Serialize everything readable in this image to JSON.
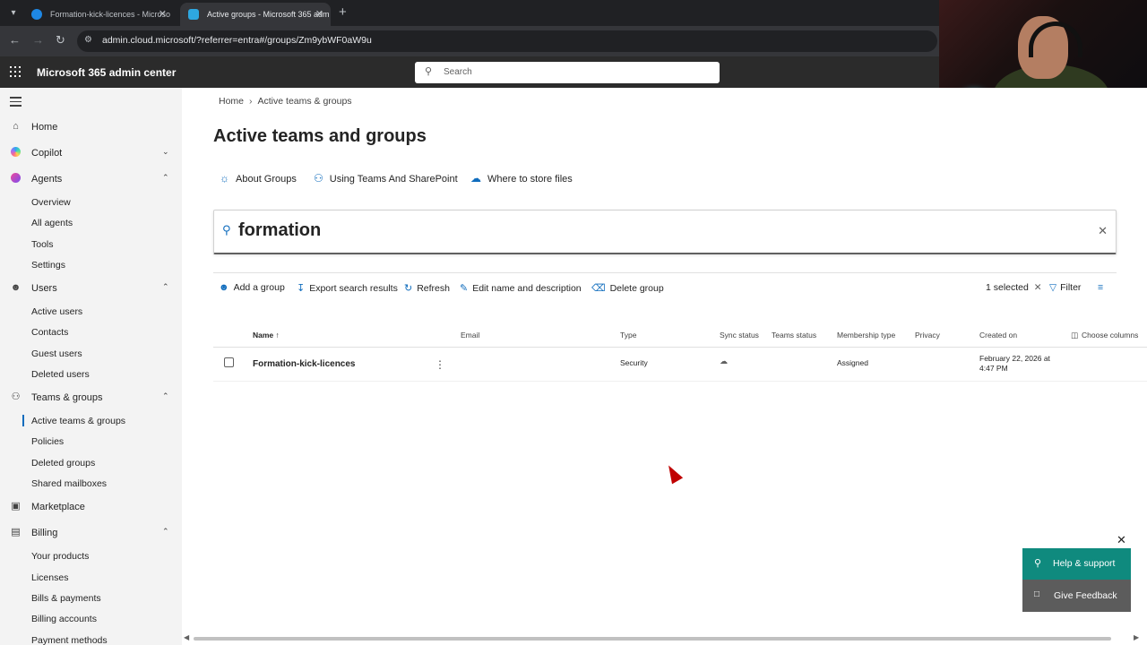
{
  "browser": {
    "tabs": [
      {
        "title": "Formation-kick-licences - Microso",
        "active": false
      },
      {
        "title": "Active groups - Microsoft 365 adm",
        "active": true
      }
    ],
    "url": "admin.cloud.microsoft/?referrer=entra#/groups/Zm9ybWF0aW9u"
  },
  "appbar": {
    "title": "Microsoft 365 admin center",
    "search_placeholder": "Search"
  },
  "sidebar": {
    "items": [
      {
        "label": "Home",
        "icon": "home-icon"
      },
      {
        "label": "Copilot",
        "icon": "copilot-icon",
        "expanded": false
      },
      {
        "label": "Agents",
        "icon": "agents-icon",
        "expanded": true,
        "children": [
          "Overview",
          "All agents",
          "Tools",
          "Settings"
        ]
      },
      {
        "label": "Users",
        "icon": "user-icon",
        "expanded": true,
        "children": [
          "Active users",
          "Contacts",
          "Guest users",
          "Deleted users"
        ]
      },
      {
        "label": "Teams & groups",
        "icon": "teams-icon",
        "expanded": true,
        "children": [
          "Active teams & groups",
          "Policies",
          "Deleted groups",
          "Shared mailboxes"
        ]
      },
      {
        "label": "Marketplace",
        "icon": "marketplace-icon"
      },
      {
        "label": "Billing",
        "icon": "billing-icon",
        "expanded": true,
        "children": [
          "Your products",
          "Licenses",
          "Bills & payments",
          "Billing accounts",
          "Payment methods"
        ]
      }
    ],
    "active_child": "Active teams & groups"
  },
  "main": {
    "breadcrumb": [
      "Home",
      "Active teams & groups"
    ],
    "title": "Active teams and groups",
    "links": [
      "About Groups",
      "Using Teams And SharePoint",
      "Where to store files"
    ],
    "search_value": "formation",
    "commands": [
      "Add a group",
      "Export search results",
      "Refresh",
      "Edit name and description",
      "Delete group"
    ],
    "selected_label": "1 selected",
    "filter_label": "Filter",
    "columns": [
      "Name",
      "Email",
      "Type",
      "Sync status",
      "Teams status",
      "Membership type",
      "Privacy",
      "Created on"
    ],
    "choose_columns": "Choose columns",
    "rows": [
      {
        "name": "Formation-kick-licences",
        "email": "",
        "type": "Security",
        "sync_icon": "cloud-icon",
        "teams_status": "",
        "membership": "Assigned",
        "privacy": "",
        "created_line1": "February 22, 2026 at",
        "created_line2": "4:47 PM"
      }
    ]
  },
  "help": {
    "help_label": "Help & support",
    "feedback_label": "Give Feedback"
  },
  "colors": {
    "accent": "#0f6cbd",
    "help_bg": "#0f8a7e",
    "feedback_bg": "#5c5c5c",
    "appbar_bg": "#2b2b2b"
  }
}
